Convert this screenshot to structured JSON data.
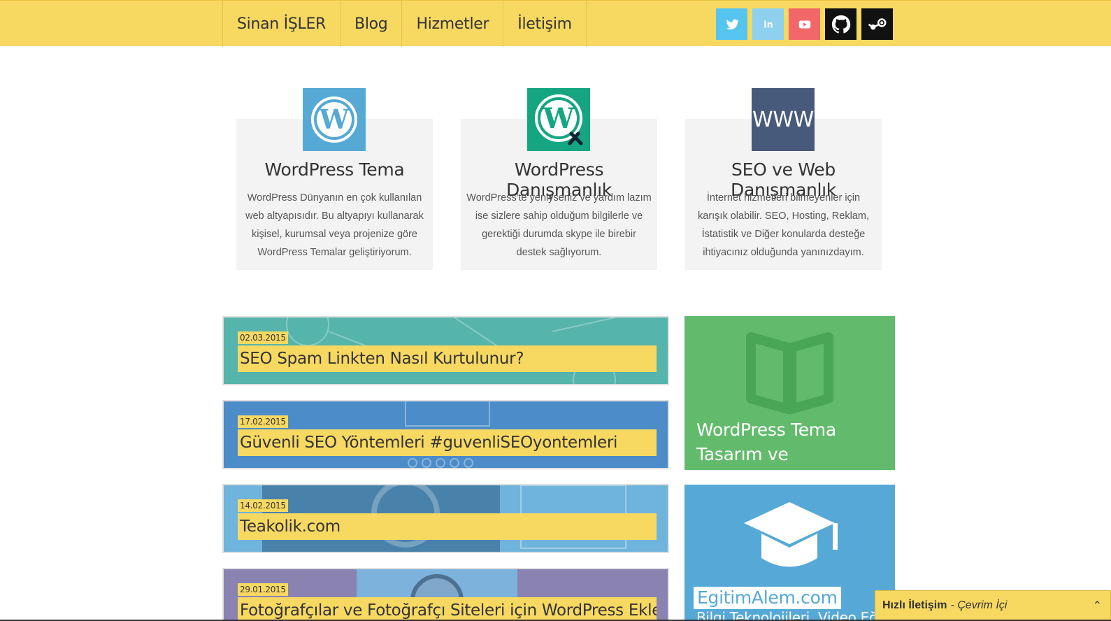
{
  "nav": {
    "items": [
      {
        "label": "Sinan İŞLER"
      },
      {
        "label": "Blog"
      },
      {
        "label": "Hizmetler"
      },
      {
        "label": "İletişim"
      }
    ]
  },
  "socials": [
    {
      "name": "twitter-icon",
      "color": "#55c5ef"
    },
    {
      "name": "linkedin-icon",
      "color": "#8ed0ee"
    },
    {
      "name": "youtube-icon",
      "color": "#f26868"
    },
    {
      "name": "github-icon",
      "color": "#111111"
    },
    {
      "name": "steam-icon",
      "color": "#111111"
    }
  ],
  "services": [
    {
      "title": "WordPress Tema",
      "desc": "WordPress Dünyanın en çok kullanılan web altyapısıdır. Bu altyapıyı kullanarak kişisel, kurumsal veya projenize göre WordPress Temalar geliştiriyorum.",
      "icon": "wordpress-icon",
      "color": "#55a9d4"
    },
    {
      "title": "WordPress Danışmanlık",
      "desc": "WordPress'te yeniyseniz ve yardım lazım ise sizlere sahip olduğum bilgilerle ve gerektiği durumda skype ile birebir destek sağlıyorum.",
      "icon": "wordpress-tools-icon",
      "color": "#15a681"
    },
    {
      "title": "SEO ve Web Danışmanlık",
      "desc": "İnternet hizmetleri bilmeyenler için karışık olabilir. SEO, Hosting, Reklam, İstatistik ve Diğer konularda desteğe ihtiyacınız olduğunda yanınızdayım.",
      "icon_text": "WWW",
      "icon": "www-icon",
      "color": "#485a7c"
    }
  ],
  "posts": [
    {
      "date": "02.03.2015",
      "title": "SEO Spam Linkten Nasıl Kurtulunur?",
      "bg": "#55b4ac"
    },
    {
      "date": "17.02.2015",
      "title": "Güvenli SEO Yöntemleri #guvenliSEOyontemleri",
      "bg": "#4c8cc9"
    },
    {
      "date": "14.02.2015",
      "title": "Teakolik.com",
      "bg": "#6fb4dc"
    },
    {
      "date": "29.01.2015",
      "title": "Fotoğrafçılar ve Fotoğrafçı Siteleri için WordPress Eklentileri",
      "bg": "#8a83b2"
    }
  ],
  "sidebar": {
    "book": {
      "title": "WordPress Tema Tasarım ve Programlama Kitabım",
      "color": "#62bb6c"
    },
    "edu": {
      "logo": "EgitimAlem.com",
      "subtitle": "Bilgi Teknolojileri, Video Eğitim",
      "color": "#56a9d6"
    }
  },
  "quick_contact": {
    "label": "Hızlı İletişim",
    "status": "- Çevrim İçi"
  }
}
